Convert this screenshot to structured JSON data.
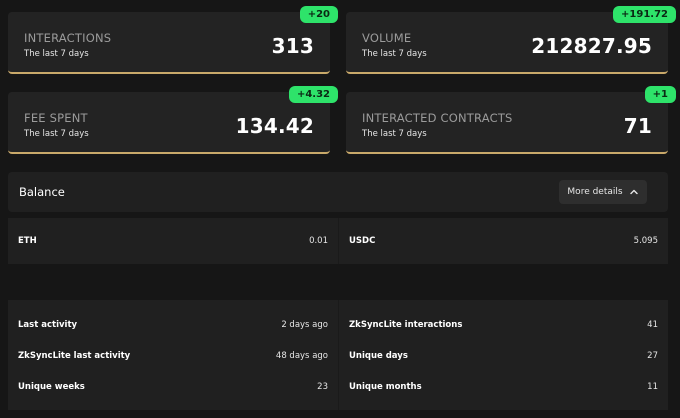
{
  "cards": [
    {
      "label": "INTERACTIONS",
      "sub": "The last 7 days",
      "value": "313",
      "badge": "+20"
    },
    {
      "label": "VOLUME",
      "sub": "The last 7 days",
      "value": "212827.95",
      "badge": "+191.72"
    },
    {
      "label": "FEE SPENT",
      "sub": "The last 7 days",
      "value": "134.42",
      "badge": "+4.32"
    },
    {
      "label": "INTERACTED CONTRACTS",
      "sub": "The last 7 days",
      "value": "71",
      "badge": "+1"
    }
  ],
  "balance": {
    "title": "Balance",
    "more_details": "More details",
    "items": [
      {
        "token": "ETH",
        "amount": "0.01"
      },
      {
        "token": "USDC",
        "amount": "5.095"
      }
    ]
  },
  "stats": [
    [
      {
        "k": "Last activity",
        "v": "2 days ago"
      },
      {
        "k": "ZkSyncLite interactions",
        "v": "41"
      }
    ],
    [
      {
        "k": "ZkSyncLite last activity",
        "v": "48 days ago"
      },
      {
        "k": "Unique days",
        "v": "27"
      }
    ],
    [
      {
        "k": "Unique weeks",
        "v": "23"
      },
      {
        "k": "Unique months",
        "v": "11"
      }
    ]
  ],
  "colors": {
    "accent_badge": "#2ee36a",
    "card_border": "#c9a96a",
    "background": "#161616"
  },
  "icons": {
    "more_details": "chevron-up-icon"
  }
}
